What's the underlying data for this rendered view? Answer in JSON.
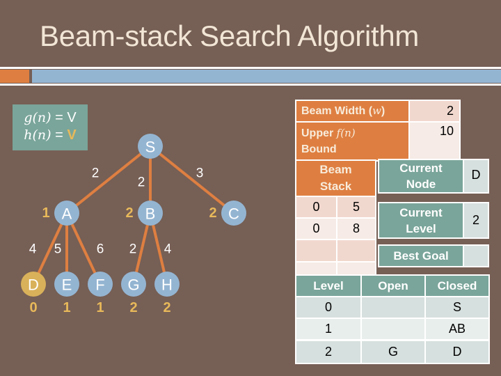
{
  "slide": {
    "title": "Beam-stack Search Algorithm",
    "colors": {
      "background": "#765f55",
      "accent_orange": "#de7f41",
      "accent_blue": "#94b5d2",
      "teal": "#7aa59a",
      "goal_node": "#d9b15a",
      "node": "#94b5d2",
      "heuristic_text": "#e8b95a"
    }
  },
  "legend": {
    "g_label": "g(n)",
    "g_eq": " = ",
    "g_val": "V",
    "h_label": "h(n)",
    "h_eq": " = ",
    "h_val": "V"
  },
  "tree": {
    "nodes": [
      {
        "id": "S",
        "label": "S",
        "h": "",
        "goal": false
      },
      {
        "id": "A",
        "label": "A",
        "h": "1",
        "goal": false
      },
      {
        "id": "B",
        "label": "B",
        "h": "2",
        "goal": false
      },
      {
        "id": "C",
        "label": "C",
        "h": "2",
        "goal": false
      },
      {
        "id": "D",
        "label": "D",
        "h": "0",
        "goal": true
      },
      {
        "id": "E",
        "label": "E",
        "h": "1",
        "goal": false
      },
      {
        "id": "F",
        "label": "F",
        "h": "1",
        "goal": false
      },
      {
        "id": "G",
        "label": "G",
        "h": "2",
        "goal": false
      },
      {
        "id": "H",
        "label": "H",
        "h": "2",
        "goal": false
      }
    ],
    "edges": [
      {
        "from": "S",
        "to": "A",
        "cost": "2"
      },
      {
        "from": "S",
        "to": "B",
        "cost": "2"
      },
      {
        "from": "S",
        "to": "C",
        "cost": "3"
      },
      {
        "from": "A",
        "to": "D",
        "cost": "4"
      },
      {
        "from": "A",
        "to": "E",
        "cost": "5"
      },
      {
        "from": "A",
        "to": "F",
        "cost": "6"
      },
      {
        "from": "B",
        "to": "G",
        "cost": "2"
      },
      {
        "from": "B",
        "to": "H",
        "cost": "4"
      }
    ]
  },
  "params": {
    "beam_width_label": "Beam Width (",
    "beam_width_var": "w",
    "beam_width_close": ")",
    "beam_width_value": "2",
    "upper_label_1": "Upper ",
    "upper_fn": "f(n)",
    "upper_label_2": "Bound",
    "upper_value": "10"
  },
  "beam_stack": {
    "header": "Beam Stack",
    "rows": [
      [
        "0",
        "5"
      ],
      [
        "0",
        "8"
      ],
      [
        "",
        ""
      ],
      [
        "",
        ""
      ]
    ]
  },
  "status": {
    "current_node_label": "Current Node",
    "current_node_value": "D",
    "current_level_label": "Current Level",
    "current_level_value": "2",
    "best_goal_label": "Best Goal",
    "best_goal_value": ""
  },
  "levels_table": {
    "headers": [
      "Level",
      "Open",
      "Closed"
    ],
    "rows": [
      [
        "0",
        "",
        "S"
      ],
      [
        "1",
        "",
        "AB"
      ],
      [
        "2",
        "G",
        "D"
      ]
    ]
  }
}
